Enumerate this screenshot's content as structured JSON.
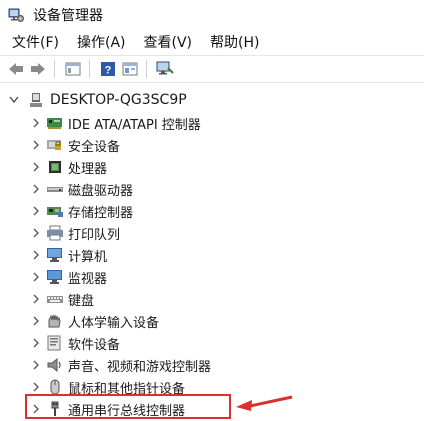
{
  "window": {
    "title": "设备管理器",
    "icon": "device-manager-icon"
  },
  "menu": [
    "文件(F)",
    "操作(A)",
    "查看(V)",
    "帮助(H)"
  ],
  "toolbar": {
    "buttons": [
      "back-arrow-icon",
      "forward-arrow-icon",
      "properties-icon",
      "help-icon",
      "view-icon",
      "scan-hardware-icon"
    ]
  },
  "tree": {
    "root": {
      "label": "DESKTOP-QG3SC9P",
      "icon": "computer-icon",
      "expanded": true
    },
    "categories": [
      {
        "label": "IDE ATA/ATAPI 控制器",
        "icon": "ide-controller-icon"
      },
      {
        "label": "安全设备",
        "icon": "security-device-icon"
      },
      {
        "label": "处理器",
        "icon": "processor-icon"
      },
      {
        "label": "磁盘驱动器",
        "icon": "disk-drive-icon"
      },
      {
        "label": "存储控制器",
        "icon": "storage-controller-icon"
      },
      {
        "label": "打印队列",
        "icon": "printer-icon"
      },
      {
        "label": "计算机",
        "icon": "computer-icon"
      },
      {
        "label": "监视器",
        "icon": "monitor-icon"
      },
      {
        "label": "键盘",
        "icon": "keyboard-icon"
      },
      {
        "label": "人体学输入设备",
        "icon": "hid-icon"
      },
      {
        "label": "软件设备",
        "icon": "software-device-icon"
      },
      {
        "label": "声音、视频和游戏控制器",
        "icon": "sound-icon"
      },
      {
        "label": "鼠标和其他指针设备",
        "icon": "mouse-icon"
      },
      {
        "label": "通用串行总线控制器",
        "icon": "usb-icon"
      }
    ]
  },
  "annotation": {
    "highlight_color": "#d9312b"
  }
}
